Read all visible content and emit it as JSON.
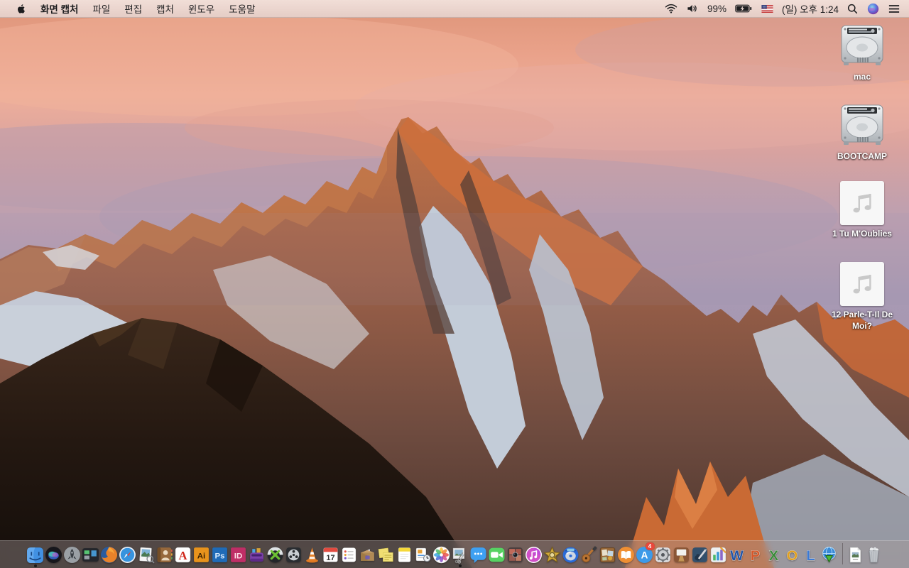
{
  "menu_bar": {
    "app_name": "화면 캡처",
    "menus": [
      "파일",
      "편집",
      "캡처",
      "윈도우",
      "도움말"
    ],
    "status": {
      "battery_percent": "99%",
      "clock": "(일) 오후 1:24",
      "icons": [
        "wifi-icon",
        "volume-icon",
        "battery-charging-icon",
        "us-flag-icon",
        "spotlight-icon",
        "siri-icon",
        "notification-center-icon"
      ]
    }
  },
  "desktop": {
    "icons": [
      {
        "label": "mac",
        "type": "hard-drive-icon"
      },
      {
        "label": "BOOTCAMP",
        "type": "hard-drive-icon"
      },
      {
        "label": "1 Tu M'Oublies",
        "type": "audio-file-icon"
      },
      {
        "label": "12 Parle-T-Il De Moi?",
        "type": "audio-file-icon"
      }
    ]
  },
  "dock": {
    "apps": [
      {
        "icon": "finder-icon",
        "running": true
      },
      {
        "icon": "siri-icon"
      },
      {
        "icon": "launchpad-icon"
      },
      {
        "icon": "mission-control-icon"
      },
      {
        "icon": "firefox-icon"
      },
      {
        "icon": "safari-icon"
      },
      {
        "icon": "preview-icon"
      },
      {
        "icon": "contacts-icon"
      },
      {
        "icon": "acrobat-icon"
      },
      {
        "icon": "illustrator-icon"
      },
      {
        "icon": "photoshop-icon"
      },
      {
        "icon": "indesign-icon"
      },
      {
        "icon": "toast-icon"
      },
      {
        "icon": "x-app-icon"
      },
      {
        "icon": "film-reel-icon"
      },
      {
        "icon": "vlc-icon"
      },
      {
        "icon": "calendar-icon",
        "date": "17"
      },
      {
        "icon": "reminders-icon"
      },
      {
        "icon": "package-icon"
      },
      {
        "icon": "stickies-icon"
      },
      {
        "icon": "notes-icon"
      },
      {
        "icon": "documents-clock-icon"
      },
      {
        "icon": "photos-icon"
      },
      {
        "icon": "screen-capture-icon",
        "running": true
      },
      {
        "icon": "messages-icon"
      },
      {
        "icon": "facetime-icon"
      },
      {
        "icon": "photo-booth-icon"
      },
      {
        "icon": "itunes-icon"
      },
      {
        "icon": "imovie-star-icon"
      },
      {
        "icon": "dvd-ripper-icon"
      },
      {
        "icon": "garageband-icon"
      },
      {
        "icon": "iweb-icon"
      },
      {
        "icon": "ibooks-icon"
      },
      {
        "icon": "app-store-icon",
        "badge": "4"
      },
      {
        "icon": "system-preferences-icon"
      },
      {
        "icon": "keynote-icon"
      },
      {
        "icon": "pages-icon"
      },
      {
        "icon": "numbers-icon"
      },
      {
        "icon": "word-icon"
      },
      {
        "icon": "powerpoint-icon"
      },
      {
        "icon": "excel-icon"
      },
      {
        "icon": "outlook-icon"
      },
      {
        "icon": "lync-icon"
      },
      {
        "icon": "globe-download-icon"
      }
    ],
    "trash_section": [
      {
        "icon": "document-file-icon"
      },
      {
        "icon": "trash-full-icon"
      }
    ]
  },
  "colors": {
    "menu-tint-top": "#f1ded7",
    "menu-tint-bottom": "#e5cdc6",
    "dock-tint": "rgba(165,152,152,0.42)",
    "badge-red": "#e8483c"
  }
}
